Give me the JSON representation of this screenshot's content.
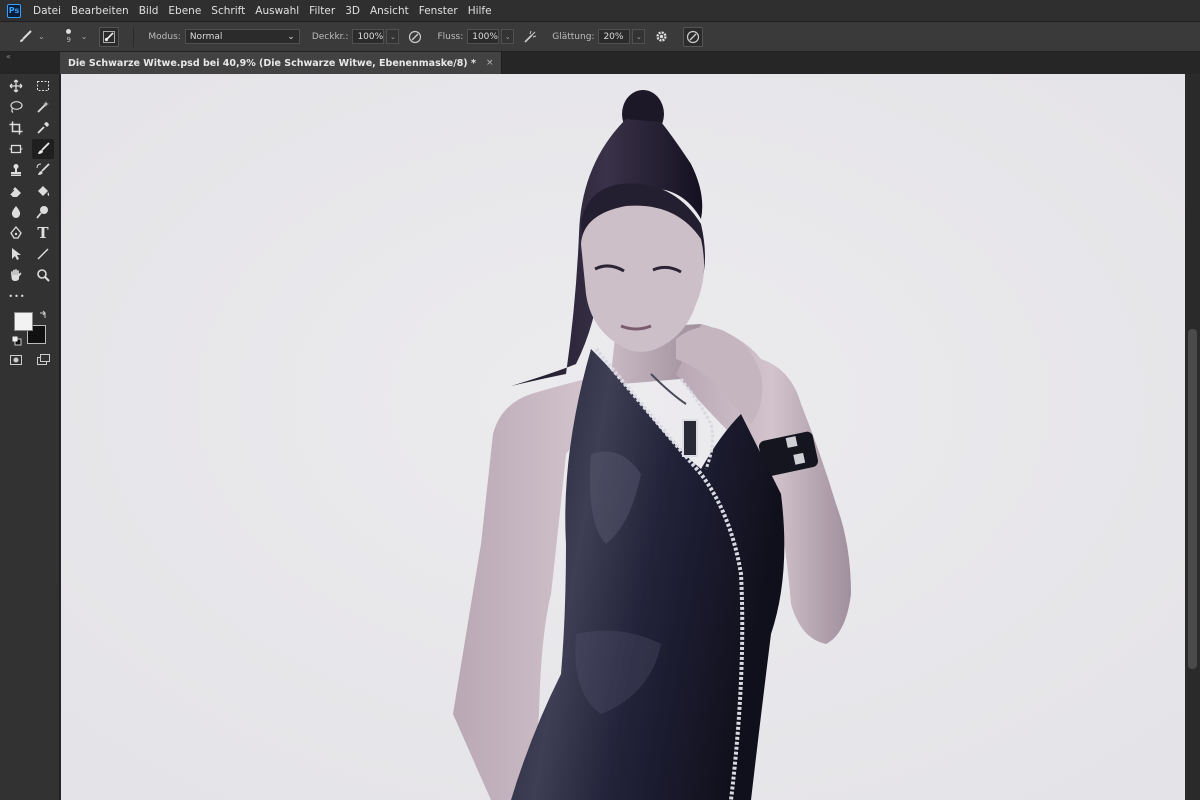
{
  "app": {
    "logo": "Ps"
  },
  "menu": {
    "items": [
      "Datei",
      "Bearbeiten",
      "Bild",
      "Ebene",
      "Schrift",
      "Auswahl",
      "Filter",
      "3D",
      "Ansicht",
      "Fenster",
      "Hilfe"
    ]
  },
  "options": {
    "brush_size": "9",
    "mode_label": "Modus:",
    "mode_value": "Normal",
    "opacity_label": "Deckkr.:",
    "opacity_value": "100%",
    "flow_label": "Fluss:",
    "flow_value": "100%",
    "smoothing_label": "Glättung:",
    "smoothing_value": "20%"
  },
  "document": {
    "tab_title": "Die Schwarze Witwe.psd bei 40,9% (Die Schwarze Witwe, Ebenenmaske/8) *",
    "close_glyph": "×"
  },
  "tabbar": {
    "collapse_glyph": "«"
  },
  "toolbar": {
    "text_tool_glyph": "T",
    "more_glyph": "•••",
    "foreground_color": "#f2f2f2",
    "background_color": "#111111"
  },
  "colors": {
    "canvas_background": "#e8e7ea",
    "panel_background": "#323232",
    "accent": "#3aa0ff"
  }
}
